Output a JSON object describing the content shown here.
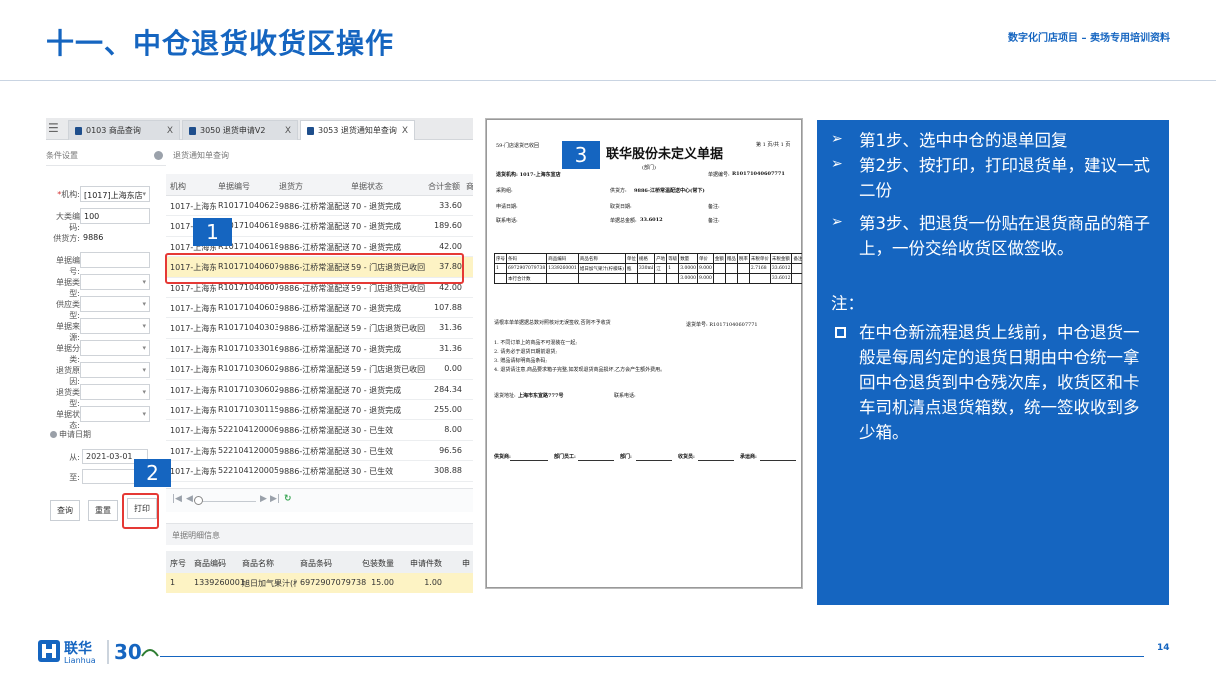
{
  "slide": {
    "title": "十一、中仓退货收货区操作",
    "header_tag": "数字化门店项目 – 卖场专用培训资料",
    "page_number": "14"
  },
  "logo": {
    "cn": "联华",
    "en": "Lianhua",
    "anniv": "30"
  },
  "erp": {
    "tabs": [
      {
        "label": "0103 商品查询",
        "close": "X"
      },
      {
        "label": "3050 退货申请V2",
        "close": "X"
      },
      {
        "label": "3053 退货通知单查询",
        "close": "X"
      }
    ],
    "condition_header": "条件设置",
    "list_header": "退货通知单查询",
    "filters": [
      {
        "label": "机构:",
        "required": "*",
        "value": "[1017]上海东店",
        "dropdown": "▾"
      },
      {
        "label": "大类编码:",
        "value": "100"
      },
      {
        "label": "供货方:",
        "value": "9886"
      },
      {
        "label": "单据编号:",
        "value": ""
      },
      {
        "label": "单据类型:",
        "value": "",
        "dropdown": "▾"
      },
      {
        "label": "供应类型:",
        "value": "",
        "dropdown": "▾"
      },
      {
        "label": "单据来源:",
        "value": "",
        "dropdown": "▾"
      },
      {
        "label": "单据分类:",
        "value": "",
        "dropdown": "▾"
      },
      {
        "label": "退货原因:",
        "value": "",
        "dropdown": "▾"
      },
      {
        "label": "退货类型:",
        "value": "",
        "dropdown": "▾"
      },
      {
        "label": "单据状态:",
        "value": "",
        "dropdown": "▾"
      }
    ],
    "date_header": "申请日期",
    "date_from_label": "从:",
    "date_from_value": "2021-03-01",
    "date_to_label": "至:",
    "date_to_value": "",
    "buttons": {
      "query": "查询",
      "reset": "重置",
      "print": "打印"
    },
    "table_headers": [
      "机构",
      "单据编号",
      "退货方",
      "单据状态",
      "合计金额",
      "商"
    ],
    "rows": [
      {
        "org": "1017-上海东...",
        "no": "R10171040623471",
        "party": "9886-江桥常温配送中心...",
        "status": "70 - 退货完成",
        "amount": "33.60"
      },
      {
        "org": "1017-上海东...",
        "no": "R10171040618969",
        "party": "9886-江桥常温配送中心...",
        "status": "70 - 退货完成",
        "amount": "189.60"
      },
      {
        "org": "1017-上海东...",
        "no": "R10171040618967",
        "party": "9886-江桥常温配送中心...",
        "status": "70 - 退货完成",
        "amount": "42.00"
      },
      {
        "org": "1017-上海东...",
        "no": "R10171040607771",
        "party": "9886-江桥常温配送中心...",
        "status": "59 - 门店退货已收回",
        "amount": "37.80"
      },
      {
        "org": "1017-上海东...",
        "no": "R10171040607769",
        "party": "9886-江桥常温配送中心...",
        "status": "59 - 门店退货已收回",
        "amount": "42.00"
      },
      {
        "org": "1017-上海东...",
        "no": "R10171040603337",
        "party": "9886-江桥常温配送中心...",
        "status": "70 - 退货完成",
        "amount": "107.88"
      },
      {
        "org": "1017-上海东...",
        "no": "R10171040303821",
        "party": "9886-江桥常温配送中心...",
        "status": "59 - 门店退货已收回",
        "amount": "31.36"
      },
      {
        "org": "1017-上海东...",
        "no": "R10171033016271",
        "party": "9886-江桥常温配送中心...",
        "status": "70 - 退货完成",
        "amount": "31.36"
      },
      {
        "org": "1017-上海东...",
        "no": "R10171030602817",
        "party": "9886-江桥常温配送中心...",
        "status": "59 - 门店退货已收回",
        "amount": "0.00"
      },
      {
        "org": "1017-上海东...",
        "no": "R10171030602473",
        "party": "9886-江桥常温配送中心...",
        "status": "70 - 退货完成",
        "amount": "284.34"
      },
      {
        "org": "1017-上海东...",
        "no": "R10171030115788",
        "party": "9886-江桥常温配送中心...",
        "status": "70 - 退货完成",
        "amount": "255.00"
      },
      {
        "org": "1017-上海东...",
        "no": "52210412000601",
        "party": "9886-江桥常温配送中心...",
        "status": "30 - 已生效",
        "amount": "8.00"
      },
      {
        "org": "1017-上海东...",
        "no": "52210412000599",
        "party": "9886-江桥常温配送中心...",
        "status": "30 - 已生效",
        "amount": "96.56"
      },
      {
        "org": "1017-上海东...",
        "no": "52210412000598",
        "party": "9886-江桥常温配送中心...",
        "status": "30 - 已生效",
        "amount": "308.88"
      }
    ],
    "selected_row_index": 3,
    "detail_header": "单据明细信息",
    "detail_headers": [
      "序号",
      "商品编码",
      "商品名称",
      "商品条码",
      "包装数量",
      "申请件数",
      "申"
    ],
    "detail_rows": [
      {
        "seq": "1",
        "code": "1339260001",
        "name": "旭日加气果汁(柠檬...",
        "barcode": "6972907079738",
        "pack": "15.00",
        "qty": "1.00"
      }
    ]
  },
  "callouts": [
    "1",
    "2",
    "3"
  ],
  "receipt": {
    "title": "联华股份未定义单据",
    "subtitle": "(部门)",
    "page_info": "第 1 页/共 1 页",
    "top_left": "59-门店退货已收回",
    "supplier": "退货机构: 1017-上海东宣店",
    "receiver": "供货方:",
    "receiver_value": "9886-江桥常温配送中心(常下)",
    "doc_no_label": "单据编号:",
    "doc_no_value": "R10171040607771",
    "contact": "采购组:",
    "apply_date": "申请日期:",
    "total_amount": "单据总金额:",
    "total_value": "33.6012",
    "fetch_date": "取货日期:",
    "remark": "备注:",
    "dept_tel": "联系电话:",
    "note_label": "备注:",
    "table_headers": [
      "序号",
      "条码",
      "商品编码",
      "商品名称",
      "单位",
      "规格",
      "产地",
      "等级",
      "数量",
      "单价",
      "金额",
      "赠品",
      "税率",
      "未税单价",
      "未税金额",
      "备注"
    ],
    "table_rows": [
      [
        "1",
        "6972907079738",
        "1339260001",
        "旭日加气果汁(柠檬味)",
        "瓶",
        "330ml",
        "江",
        "1",
        "3.0000",
        "9.000",
        "",
        "",
        "",
        "2.7168",
        "33.6012",
        ""
      ],
      [
        "",
        "本行合计数",
        "",
        "",
        "",
        "",
        "",
        "",
        "3.0000",
        "9.000",
        "",
        "",
        "",
        "",
        "33.6012",
        ""
      ]
    ],
    "statement": "请根本单单据据总数对照核对无误签收,否则不予收货",
    "ref_no": "退货单号: R10171040607771",
    "rules": [
      "1. 不同订单上的商品不可混装在一起;",
      "2. 请务必于退货日期前退货;",
      "3. 赠品请标明商品条码;",
      "4. 退货请注意,商品要求箱子完整,如发现退货商品损坏,乙方会产生额外费用。"
    ],
    "address_label": "退货地址:",
    "address_value": "上海市东宣路777号",
    "contact_label": "联系电话:",
    "signatures": [
      "供货商:",
      "部门员工:",
      "部门:",
      "收货员:",
      "承运商:"
    ]
  },
  "info": {
    "steps": [
      "第1步、选中中仓的退单回复",
      "第2步、按打印，打印退货单，建议一式二份",
      "第3步、把退货一份贴在退货商品的箱子上，一份交给收货区做签收。"
    ],
    "note_label": "注：",
    "note_text": "在中仓新流程退货上线前，中仓退货一般是每周约定的退货日期由中仓统一拿回中仓退货到中仓残次库，收货区和卡车司机清点退货箱数，统一签收收到多少箱。"
  },
  "colors": {
    "accent": "#1565c0",
    "highlight_row": "#fdf3c4",
    "callout_border": "#e53935"
  }
}
